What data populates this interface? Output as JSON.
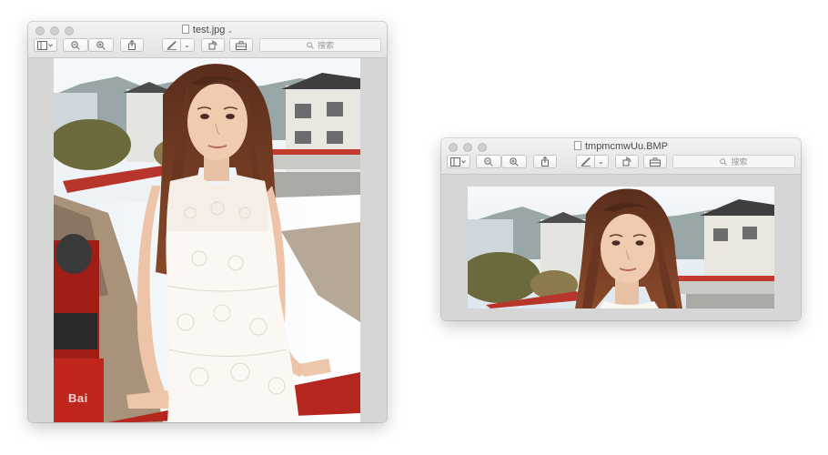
{
  "window_left": {
    "title": "test.jpg",
    "search_placeholder": "搜索",
    "watermark": "Bai"
  },
  "window_right": {
    "title": "tmpmcmwUu.BMP",
    "search_placeholder": "搜索"
  }
}
